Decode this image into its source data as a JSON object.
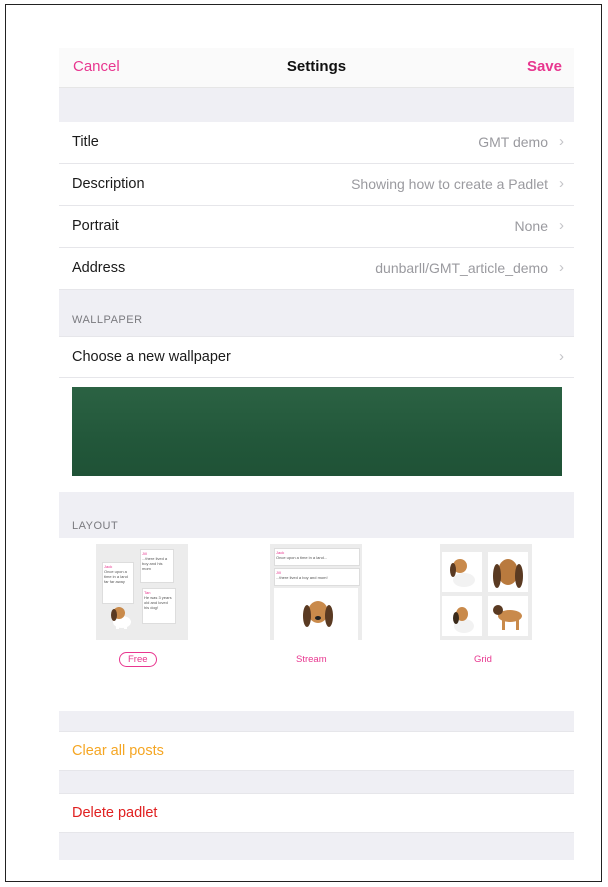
{
  "nav": {
    "cancel": "Cancel",
    "title": "Settings",
    "save": "Save"
  },
  "rows": [
    {
      "label": "Title",
      "value": "GMT demo"
    },
    {
      "label": "Description",
      "value": "Showing how to create a Padlet"
    },
    {
      "label": "Portrait",
      "value": "None"
    },
    {
      "label": "Address",
      "value": "dunbarll/GMT_article_demo"
    }
  ],
  "wallpaper": {
    "header": "WALLPAPER",
    "choose_label": "Choose a new wallpaper",
    "color": "#22573a"
  },
  "layout": {
    "header": "LAYOUT",
    "options": [
      {
        "label": "Free",
        "selected": true
      },
      {
        "label": "Stream",
        "selected": false
      },
      {
        "label": "Grid",
        "selected": false
      }
    ],
    "free_notes": [
      {
        "name": "Jack",
        "text": "Once upon a time in a land far far away"
      },
      {
        "name": "Jill",
        "text": "...there lived a boy and his mom"
      },
      {
        "name": "Tan",
        "text": "He was 3 years old and loved his dog!"
      }
    ],
    "stream_notes": [
      {
        "name": "Jack",
        "text": "Once upon a time in a land..."
      },
      {
        "name": "Jill",
        "text": "...there lived a boy and mom!"
      }
    ]
  },
  "actions": {
    "clear": "Clear all posts",
    "delete": "Delete padlet"
  },
  "colors": {
    "accent": "#e8368f",
    "clear": "#f5a623",
    "delete": "#e02020",
    "group_bg": "#efeff4"
  },
  "icons": {
    "chevron": "›"
  }
}
